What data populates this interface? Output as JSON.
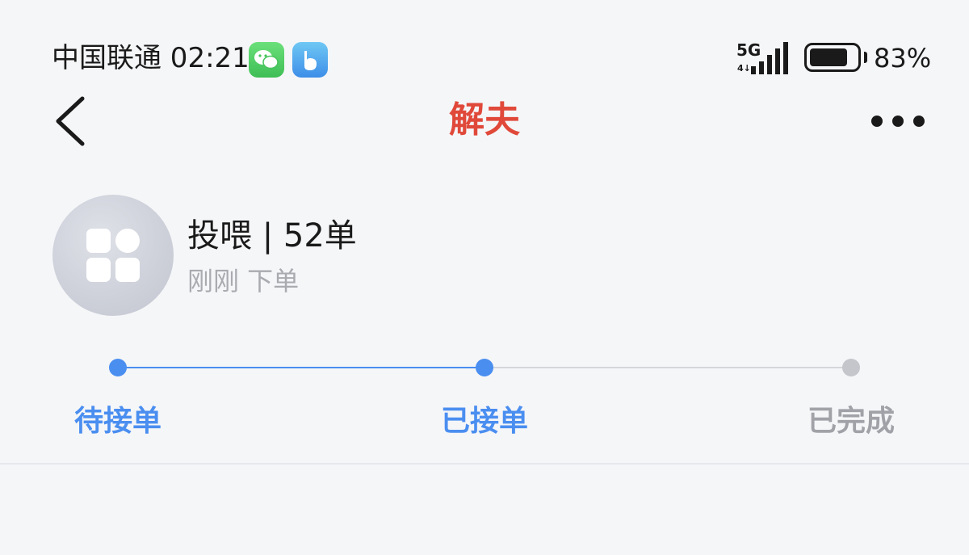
{
  "status_bar": {
    "carrier_time": "中国联通 02:21",
    "network": "5G",
    "network_sub": "4↓",
    "battery_percent": "83%",
    "battery_level": 0.83,
    "app_icons": [
      "wechat-icon",
      "blue-app-icon"
    ]
  },
  "nav": {
    "title": "解夫",
    "title_color": "#e0493a",
    "back_icon": "chevron-left-icon",
    "more_icon": "more-dots-icon"
  },
  "order": {
    "title": "投喂 | 52单",
    "subtitle": "刚刚 下单",
    "avatar_icon": "apps-grid-icon"
  },
  "progress": {
    "active_color": "#4a8ef0",
    "inactive_color": "#c4c6cc",
    "steps": [
      {
        "label": "待接单",
        "state": "active"
      },
      {
        "label": "已接单",
        "state": "active"
      },
      {
        "label": "已完成",
        "state": "inactive"
      }
    ]
  }
}
